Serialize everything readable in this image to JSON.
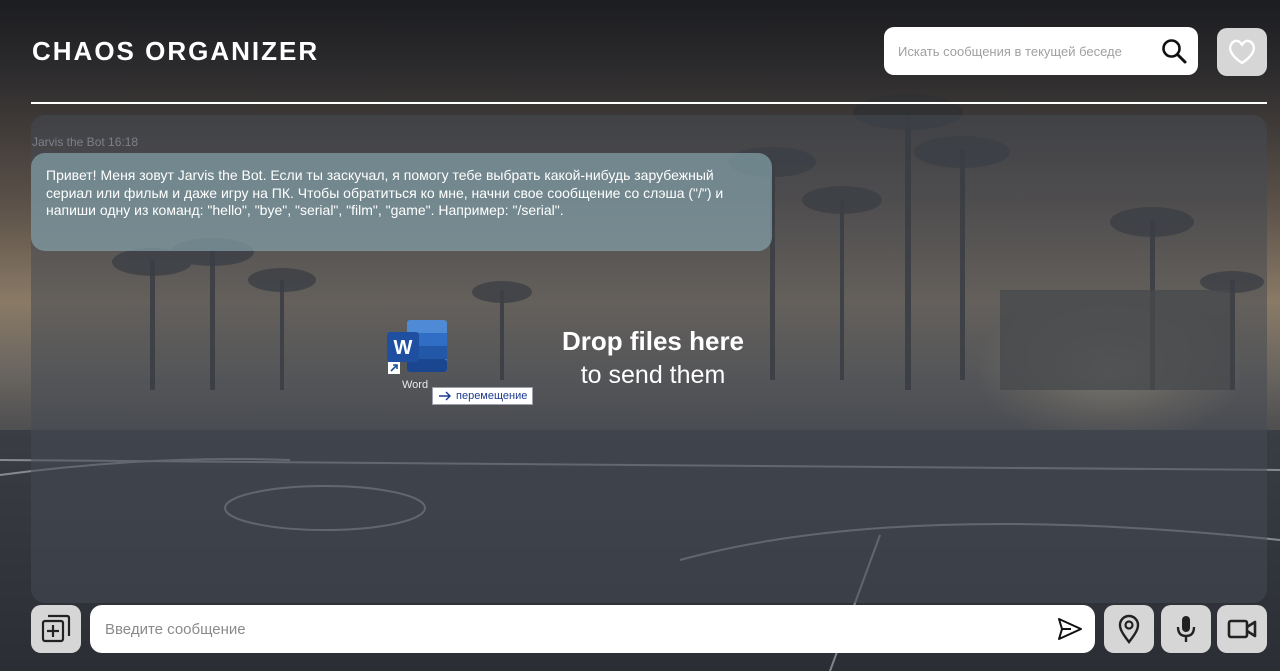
{
  "app": {
    "title": "CHAOS ORGANIZER"
  },
  "header": {
    "search": {
      "placeholder": "Искать сообщения в текущей беседе",
      "icon": "search-icon"
    },
    "favorites_icon": "heart-icon"
  },
  "chat": {
    "messages": [
      {
        "author": "Jarvis the Bot",
        "time": "16:18",
        "meta": "Jarvis the Bot 16:18",
        "text": "Привет! Меня зовут Jarvis the Bot. Если ты заскучал, я помогу тебе выбрать какой-нибудь зарубежный сериал или фильм и даже игру на ПК. Чтобы обратиться ко мне, начни свое сообщение со слэша (\"/\") и напиши одну из команд: \"hello\", \"bye\", \"serial\", \"film\", \"game\". Например: \"/serial\"."
      }
    ],
    "drop_overlay": {
      "title": "Drop files here",
      "subtitle": "to send them",
      "dragged_file_label": "Word",
      "drag_hint": "перемещение",
      "dragged_file_icon": "word-document-icon"
    }
  },
  "composer": {
    "placeholder": "Введите сообщение",
    "buttons": {
      "attach_icon": "add-file-icon",
      "send_icon": "send-icon",
      "location_icon": "location-pin-icon",
      "audio_icon": "microphone-icon",
      "video_icon": "video-camera-icon"
    }
  },
  "colors": {
    "text_light": "#ffffff",
    "button_bg": "#d6d6d6",
    "bubble_bg": "#82a0a8",
    "meta_text": "#7d8089",
    "word_blue": "#2b5797"
  }
}
